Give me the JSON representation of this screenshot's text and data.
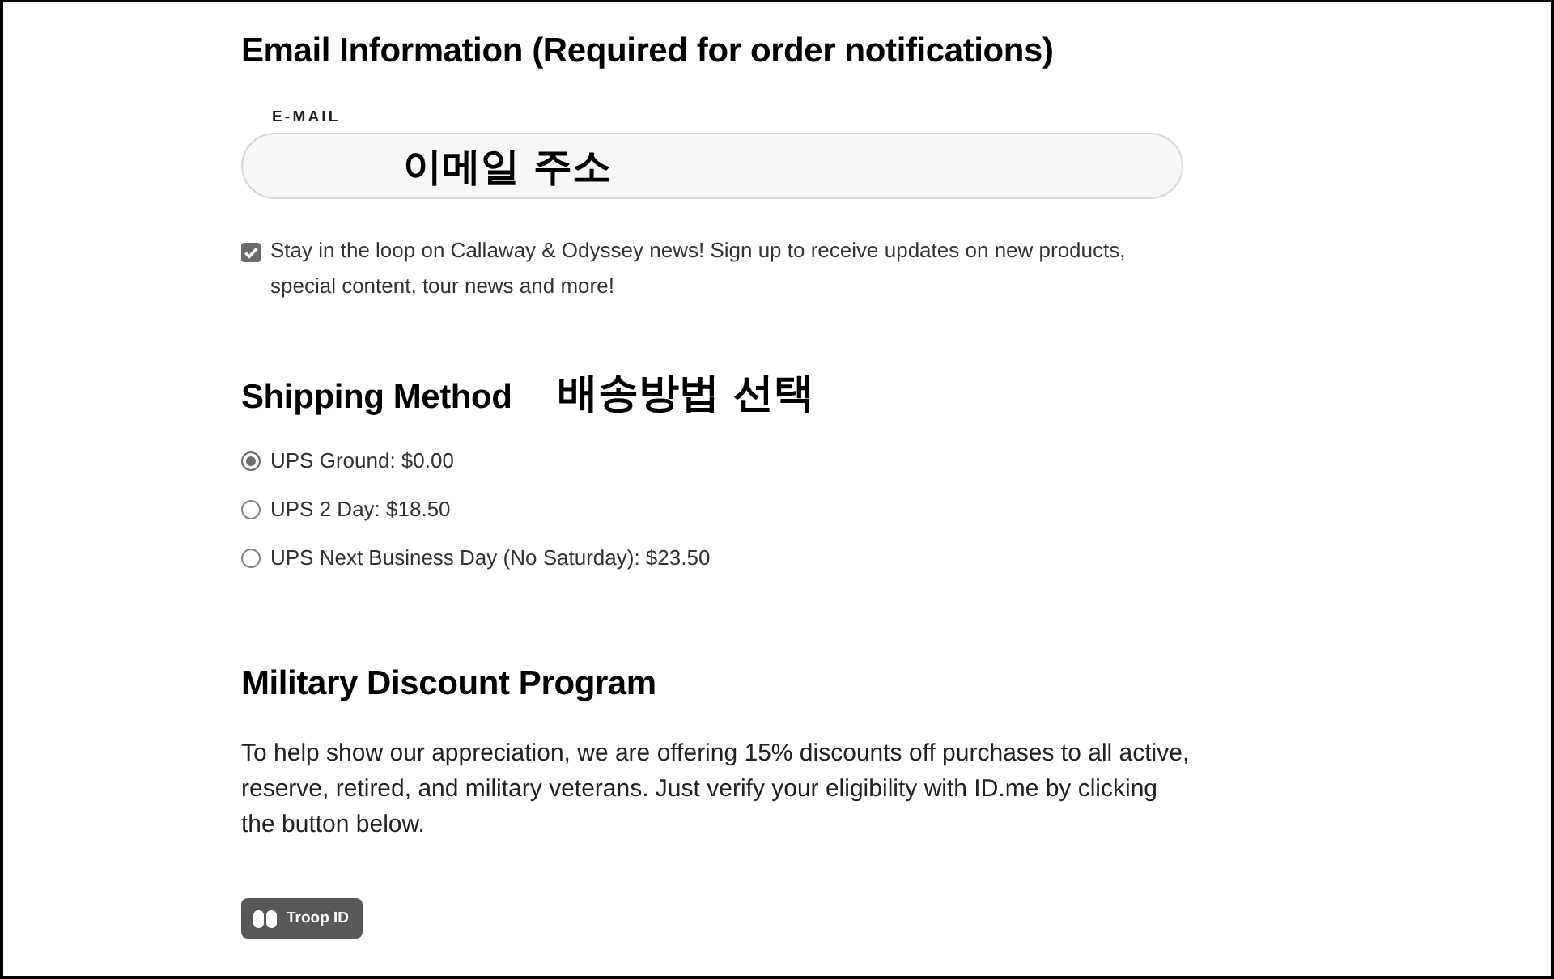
{
  "email_section": {
    "heading": "Email Information (Required for order notifications)",
    "field_label": "E-MAIL",
    "field": {
      "value": "이메일 주소"
    },
    "newsletter": {
      "checked": true,
      "label": "Stay in the loop on Callaway & Odyssey news! Sign up to receive updates on new products, special content, tour news and more!"
    }
  },
  "shipping_section": {
    "heading": "Shipping Method",
    "annotation": "배송방법 선택",
    "options": [
      {
        "label": "UPS Ground: $0.00",
        "selected": true
      },
      {
        "label": "UPS 2 Day: $18.50",
        "selected": false
      },
      {
        "label": "UPS Next Business Day (No Saturday): $23.50",
        "selected": false
      }
    ]
  },
  "military_section": {
    "heading": "Military Discount Program",
    "text": "To help show our appreciation, we are offering 15% discounts off purchases to all active, reserve, retired, and military veterans. Just verify your eligibility with ID.me by clicking the button below.",
    "button": "Troop ID"
  }
}
